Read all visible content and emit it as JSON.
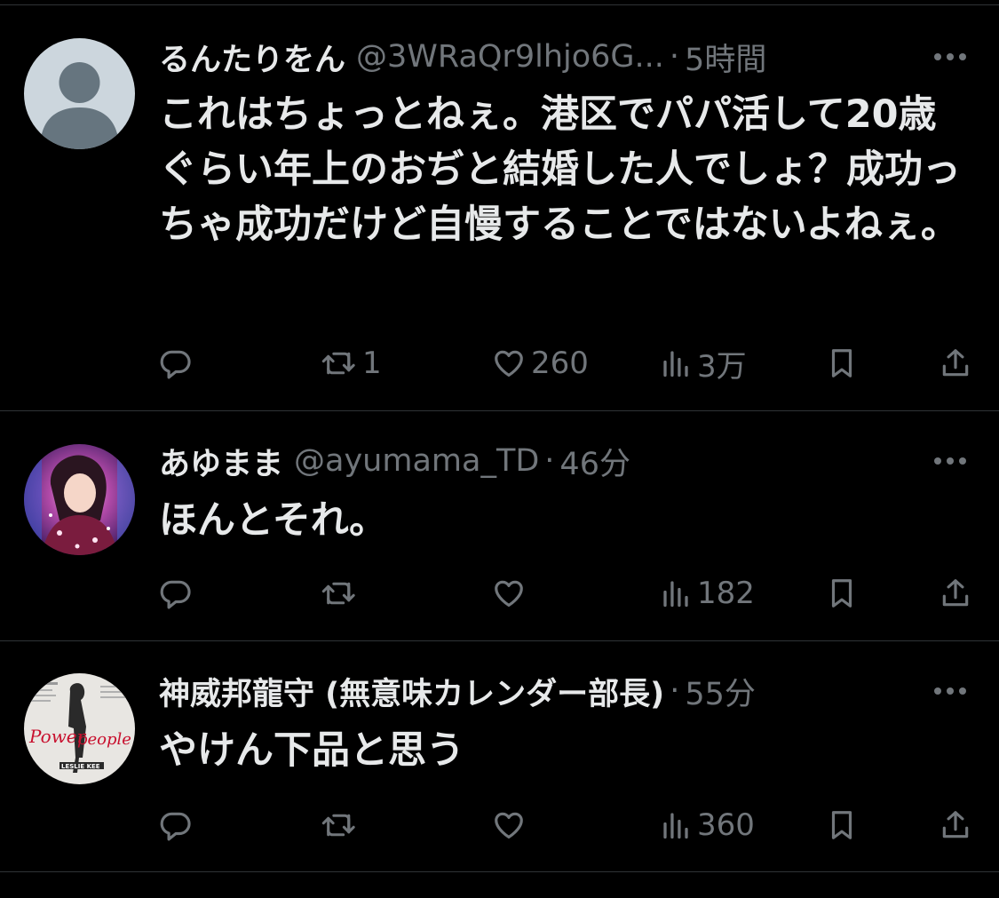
{
  "tweets": [
    {
      "display_name": "るんたりをん",
      "handle": "@3WRaQr9lhjo6G...",
      "separator": "·",
      "time": "5時間",
      "text": "これはちょっとねぇ。港区でパパ活して20歳ぐらい年上のおぢと結婚した人でしょ？成功っちゃ成功だけど自慢することではないよねぇ。",
      "reply_count": "",
      "retweet_count": "1",
      "like_count": "260",
      "view_count": "3万",
      "avatar": "default-avatar"
    },
    {
      "display_name": "あゆまま",
      "handle": "@ayumama_TD",
      "separator": "·",
      "time": "46分",
      "text": "ほんとそれ。",
      "reply_count": "",
      "retweet_count": "",
      "like_count": "",
      "view_count": "182",
      "avatar": "photo-avatar"
    },
    {
      "display_name": "神威邦龍守 (無意味カレンダー部長)",
      "handle": "",
      "separator": "·",
      "time": "55分",
      "text": "やけん下品と思う",
      "reply_count": "",
      "retweet_count": "",
      "like_count": "",
      "view_count": "360",
      "avatar": "poster-avatar"
    }
  ],
  "icons": {
    "more": "more-horizontal-icon",
    "reply": "reply-icon",
    "retweet": "retweet-icon",
    "like": "heart-icon",
    "views": "views-chart-icon",
    "bookmark": "bookmark-icon",
    "share": "share-icon"
  },
  "colors": {
    "background": "#000000",
    "primary_text": "#e7e9ea",
    "secondary_text": "#71767b",
    "divider": "#2f3336"
  }
}
